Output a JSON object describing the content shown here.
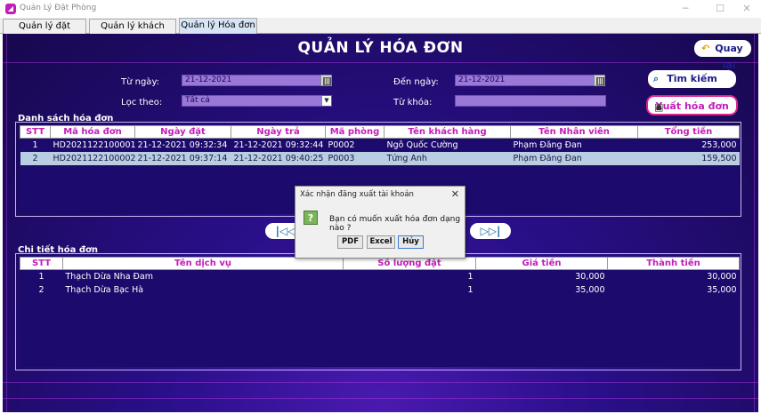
{
  "window": {
    "title": "Quản Lý Đặt Phòng"
  },
  "tabs": [
    "Quản lý đặt phòng",
    "Quản lý khách hàng",
    "Quản lý Hóa đơn"
  ],
  "header": {
    "title": "QUẢN LÝ HÓA ĐƠN",
    "back_label": "Quay lại"
  },
  "filters": {
    "from_label": "Từ ngày:",
    "from_value": "21-12-2021",
    "to_label": "Đến ngày:",
    "to_value": "21-12-2021",
    "filter_label": "Lọc theo:",
    "filter_value": "Tất cả",
    "keyword_label": "Từ khóa:",
    "keyword_value": ""
  },
  "actions": {
    "search_label": "Tìm kiếm",
    "export_label": "Xuất hóa đơn"
  },
  "invoices": {
    "section_title": "Danh sách hóa đơn",
    "columns": [
      "STT",
      "Mã hóa đơn",
      "Ngày đặt",
      "Ngày trả",
      "Mã phòng",
      "Tên khách hàng",
      "Tên Nhân viên",
      "Tổng tiền"
    ],
    "rows": [
      [
        "1",
        "HD2021122100001",
        "21-12-2021 09:32:34",
        "21-12-2021 09:32:44",
        "P0002",
        "Ngô Quốc Cường",
        "Phạm Đăng Đan",
        "253,000"
      ],
      [
        "2",
        "HD2021122100002",
        "21-12-2021 09:37:14",
        "21-12-2021 09:40:25",
        "P0003",
        "Tứng Anh",
        "Phạm Đăng Đan",
        "159,500"
      ]
    ]
  },
  "nav": {
    "prev_label": "|◁◁",
    "next_label": "▷▷|"
  },
  "details": {
    "section_title": "Chi tiết hóa đơn",
    "columns": [
      "STT",
      "Tên dịch vụ",
      "Số lượng đặt",
      "Giá tiền",
      "Thành tiền"
    ],
    "rows": [
      [
        "1",
        "Thạch Dừa Nha Đam",
        "1",
        "30,000",
        "30,000"
      ],
      [
        "2",
        "Thạch Dừa Bạc Hà",
        "1",
        "35,000",
        "35,000"
      ]
    ]
  },
  "dialog": {
    "title": "Xác nhận đăng xuất tài khoản",
    "message": "Bạn có muốn xuất hóa đơn dạng nào ?",
    "buttons": [
      "PDF",
      "Excel",
      "Hủy"
    ]
  },
  "colors": {
    "accent": "#c21db8",
    "background": "#2a0f8a",
    "selection": "#b9cde3"
  }
}
